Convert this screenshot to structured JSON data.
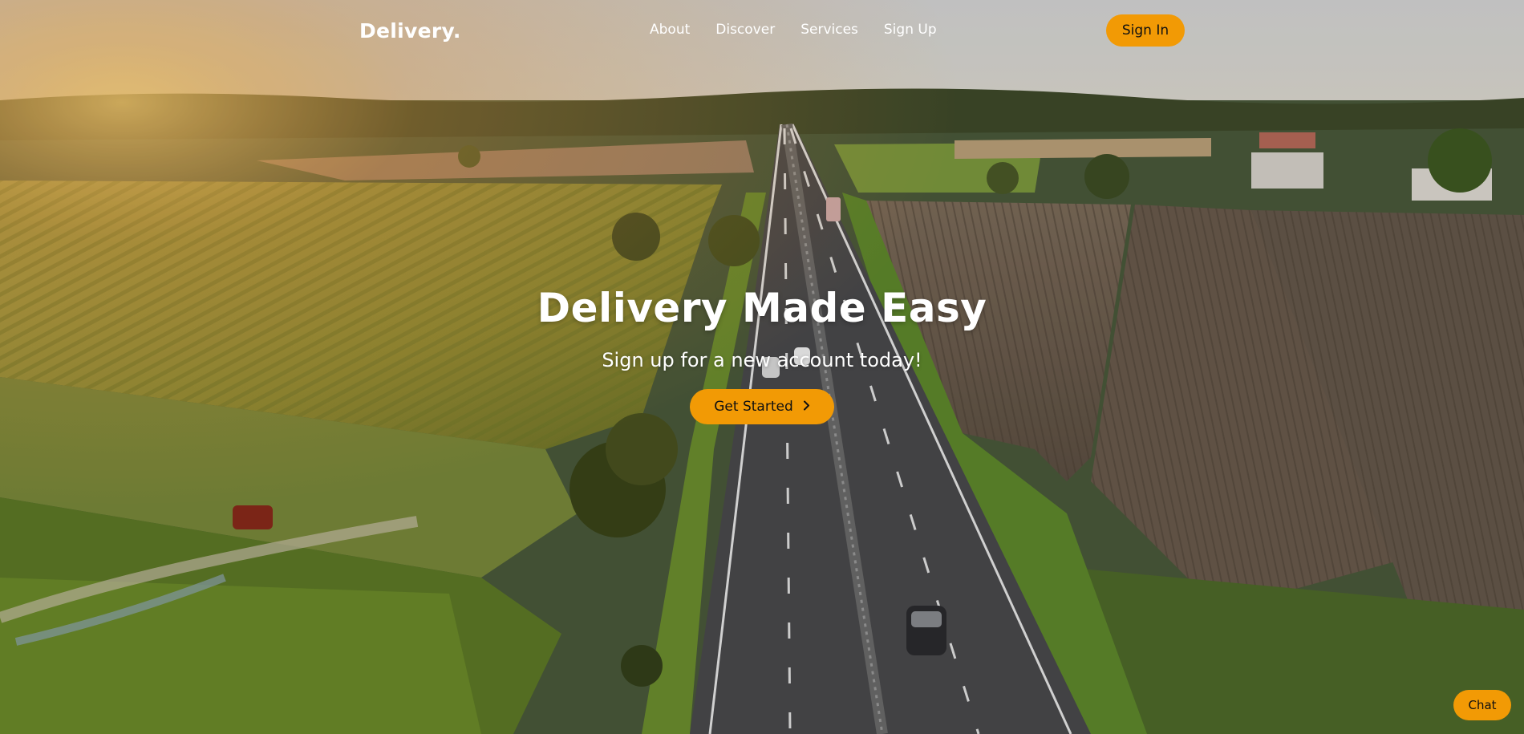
{
  "brand": {
    "logo_text": "Delivery."
  },
  "nav": {
    "links": [
      "About",
      "Discover",
      "Services",
      "Sign Up"
    ],
    "sign_in_label": "Sign In"
  },
  "hero": {
    "title": "Delivery Made Easy",
    "subtitle": "Sign up for a new account today!",
    "cta_label": "Get Started",
    "cta_icon": "chevron-right-icon"
  },
  "chat": {
    "label": "Chat"
  },
  "colors": {
    "accent": "#f29a05",
    "text_light": "#ffffff",
    "text_dark": "#111111"
  }
}
